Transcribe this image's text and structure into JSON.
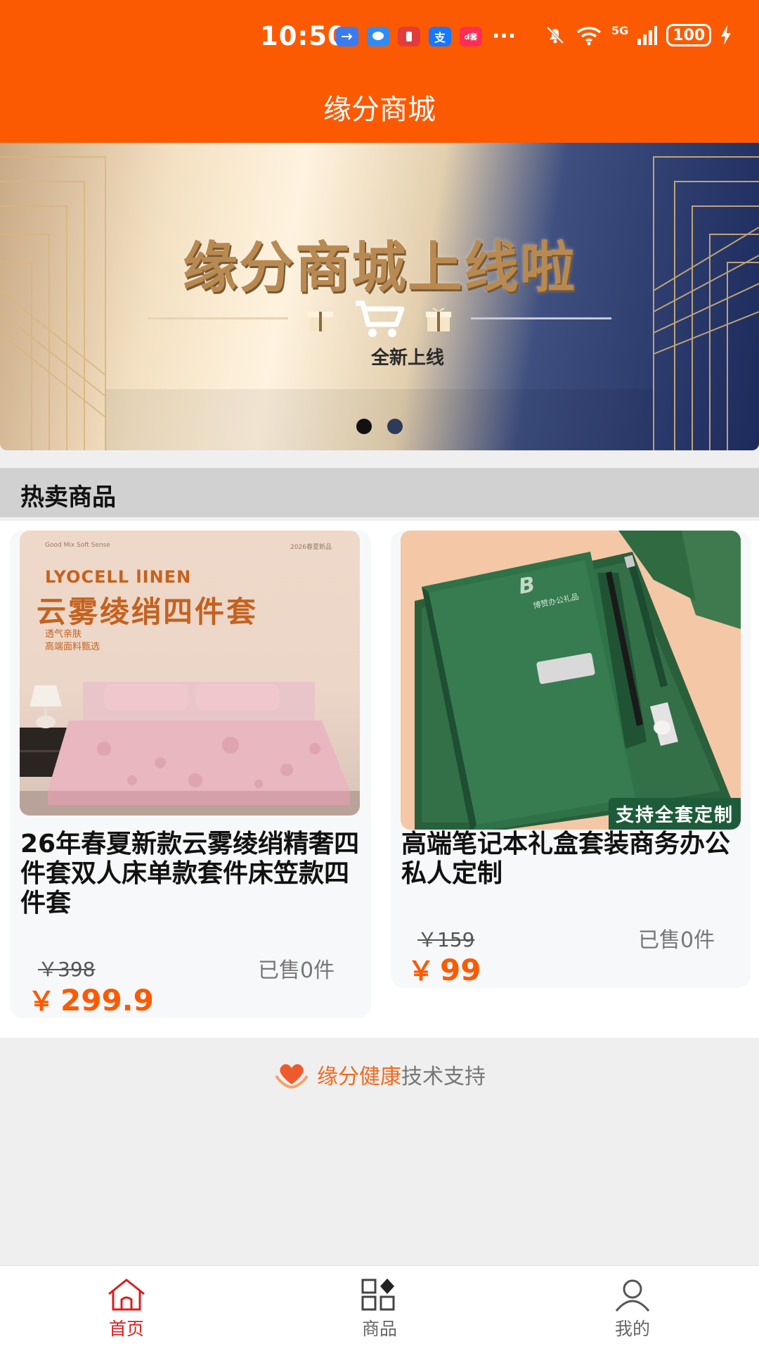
{
  "status_bar": {
    "time": "10:50",
    "network": "5G",
    "battery": "100",
    "notif_pay": "支",
    "notif_red": "d套",
    "more": "···"
  },
  "header": {
    "title": "缘分商城"
  },
  "banner": {
    "title": "缘分商城上线啦",
    "subtitle": "全新上线",
    "slide_count": 2,
    "active_slide": 1
  },
  "section": {
    "title": "热卖商品"
  },
  "products": [
    {
      "name": "26年春夏新款云雾绫绡精奢四件套双人床单款套件床笠款四件套",
      "original_price": "￥398",
      "sold": "已售0件",
      "price_symbol": "￥",
      "price": "299.9",
      "image": {
        "brand_text": "LYOCELL lINEN",
        "headline": "云雾绫绡四件套",
        "top_text": "Good Mix Soft Sense",
        "tag": "2026春夏新品",
        "sub1": "透气亲肤",
        "sub2": "高端面料甄选"
      }
    },
    {
      "name": "高端笔记本礼盒套装商务办公 私人定制",
      "original_price": "￥159",
      "sold": "已售0件",
      "price_symbol": "￥",
      "price": "99",
      "image": {
        "badge": "支持全套定制",
        "brand_text": "博赞办公礼品"
      }
    }
  ],
  "credit": {
    "brand": "缘分健康",
    "text": "技术支持"
  },
  "bottom_nav": [
    {
      "label": "首页",
      "icon": "home-icon",
      "active": true
    },
    {
      "label": "商品",
      "icon": "grid-icon",
      "active": false
    },
    {
      "label": "我的",
      "icon": "user-icon",
      "active": false
    }
  ],
  "colors": {
    "brand": "#fb5a03",
    "active_nav": "#d81e1e",
    "price": "#fb5a03"
  }
}
